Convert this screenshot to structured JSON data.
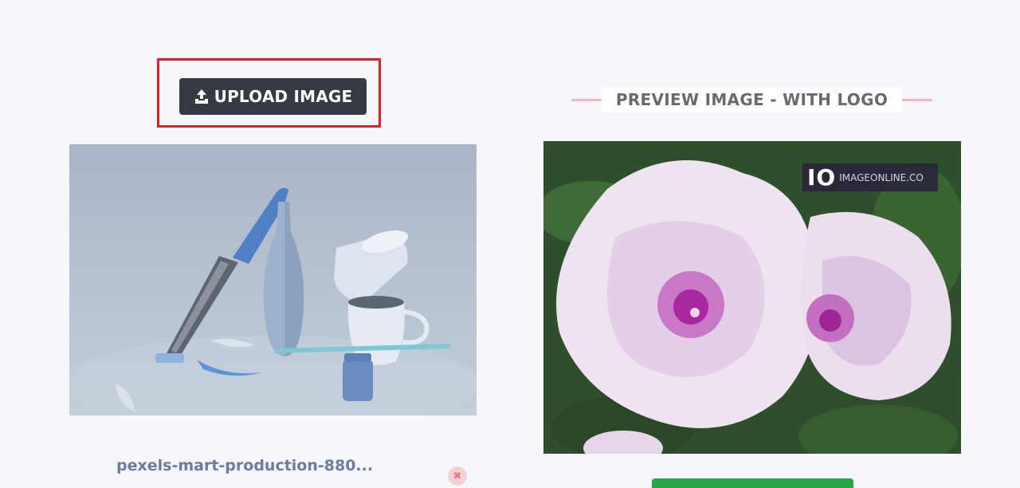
{
  "upload": {
    "label": "UPLOAD IMAGE",
    "icon": "upload-icon"
  },
  "source": {
    "filename": "pexels-mart-production-880...",
    "remove_icon": "close-icon",
    "remove_symbol": "✖"
  },
  "preview": {
    "heading": "PREVIEW IMAGE - WITH LOGO",
    "logo_mark": "IO",
    "logo_text": "IMAGEONLINE.CO"
  },
  "colors": {
    "accent_highlight": "#d9232b",
    "upload_button": "#343a40",
    "download_button": "#28a745",
    "heading_line": "#f6b9c1"
  }
}
